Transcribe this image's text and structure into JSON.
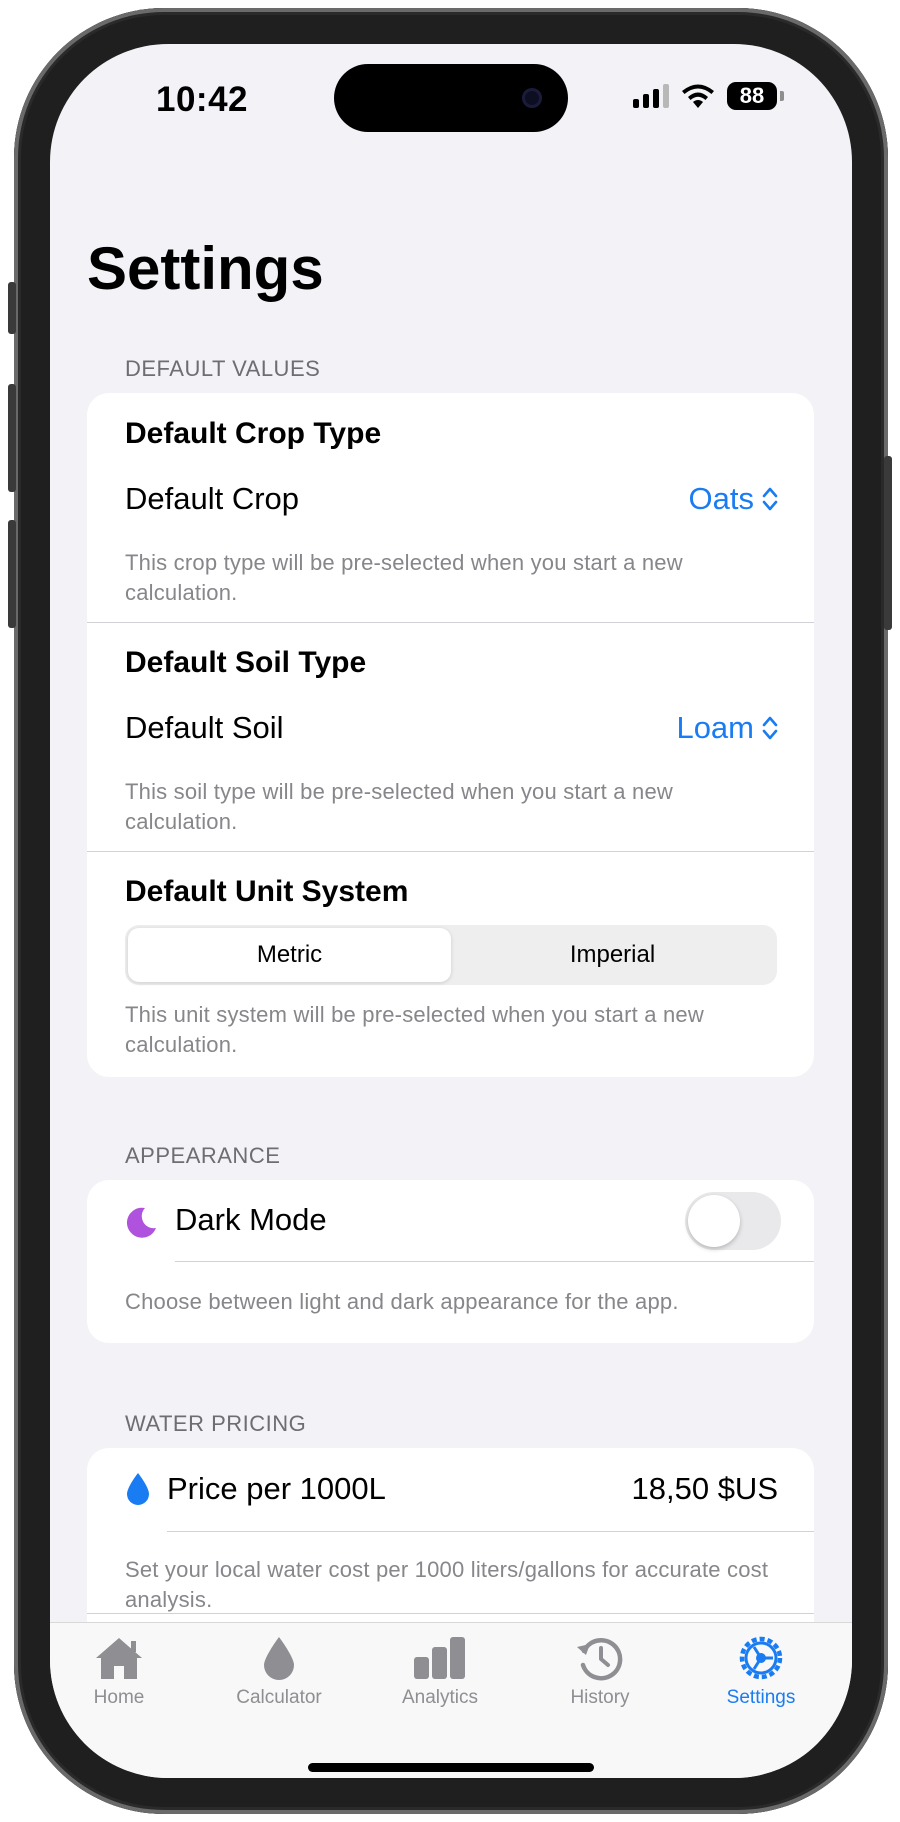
{
  "status_bar": {
    "time": "10:42",
    "battery": "88"
  },
  "page": {
    "title": "Settings"
  },
  "default_values": {
    "header": "DEFAULT VALUES",
    "crop": {
      "title": "Default Crop Type",
      "label": "Default Crop",
      "value": "Oats",
      "footnote": "This crop type will be pre-selected when you start a new calculation."
    },
    "soil": {
      "title": "Default Soil Type",
      "label": "Default Soil",
      "value": "Loam",
      "footnote": "This soil type will be pre-selected when you start a new calculation."
    },
    "units": {
      "title": "Default Unit System",
      "options": [
        "Metric",
        "Imperial"
      ],
      "selected": "Metric",
      "footnote": "This unit system will be pre-selected when you start a new calculation."
    }
  },
  "appearance": {
    "header": "APPEARANCE",
    "dark_mode_label": "Dark Mode",
    "dark_mode_on": false,
    "footnote": "Choose between light and dark appearance for the app."
  },
  "water_pricing": {
    "header": "WATER PRICING",
    "price_label": "Price per 1000L",
    "price_value": "18,50 $US",
    "footnote": "Set your local water cost per 1000 liters/gallons for accurate cost analysis."
  },
  "tabs": [
    {
      "label": "Home",
      "icon": "house-icon",
      "active": false
    },
    {
      "label": "Calculator",
      "icon": "drop-icon",
      "active": false
    },
    {
      "label": "Analytics",
      "icon": "bar-chart-icon",
      "active": false
    },
    {
      "label": "History",
      "icon": "clock-history-icon",
      "active": false
    },
    {
      "label": "Settings",
      "icon": "gear-icon",
      "active": true
    }
  ],
  "colors": {
    "accent": "#1a7cf2",
    "background": "#f2f2f7",
    "moon": "#af52de",
    "inactive_tab": "#8e8e93"
  }
}
